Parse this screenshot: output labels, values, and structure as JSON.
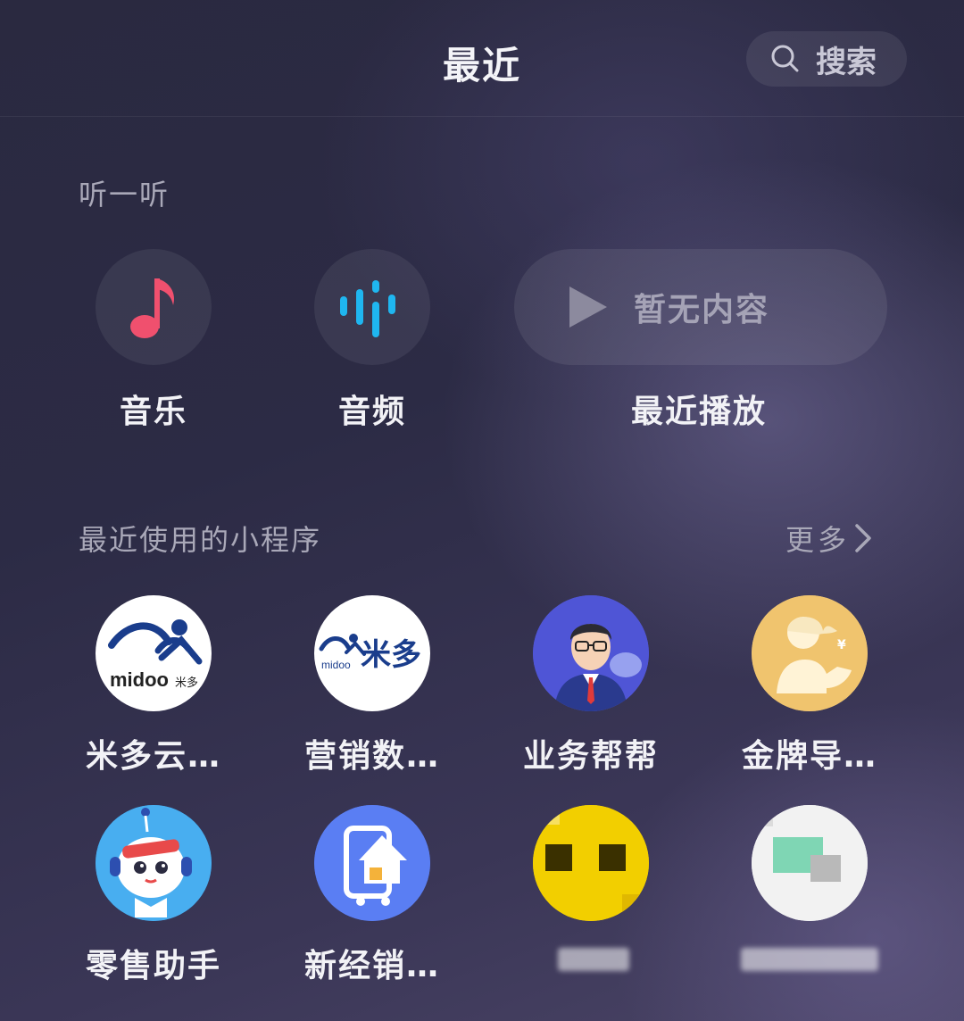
{
  "header": {
    "title": "最近",
    "search_label": "搜索"
  },
  "listen": {
    "section_title": "听一听",
    "music_label": "音乐",
    "audio_label": "音频",
    "recent_empty_text": "暂无内容",
    "recent_label": "最近播放"
  },
  "mini_programs": {
    "section_title": "最近使用的小程序",
    "more_label": "更多",
    "items": [
      {
        "label": "米多云…"
      },
      {
        "label": "营销数…"
      },
      {
        "label": "业务帮帮"
      },
      {
        "label": "金牌导…"
      },
      {
        "label": "零售助手"
      },
      {
        "label": "新经销…"
      }
    ],
    "blurred_count_note": ""
  },
  "colors": {
    "music_accent": "#f0506e",
    "audio_accent": "#1fb6f0",
    "text_primary": "#f2f2f6",
    "text_secondary": "#a9a8b8"
  }
}
